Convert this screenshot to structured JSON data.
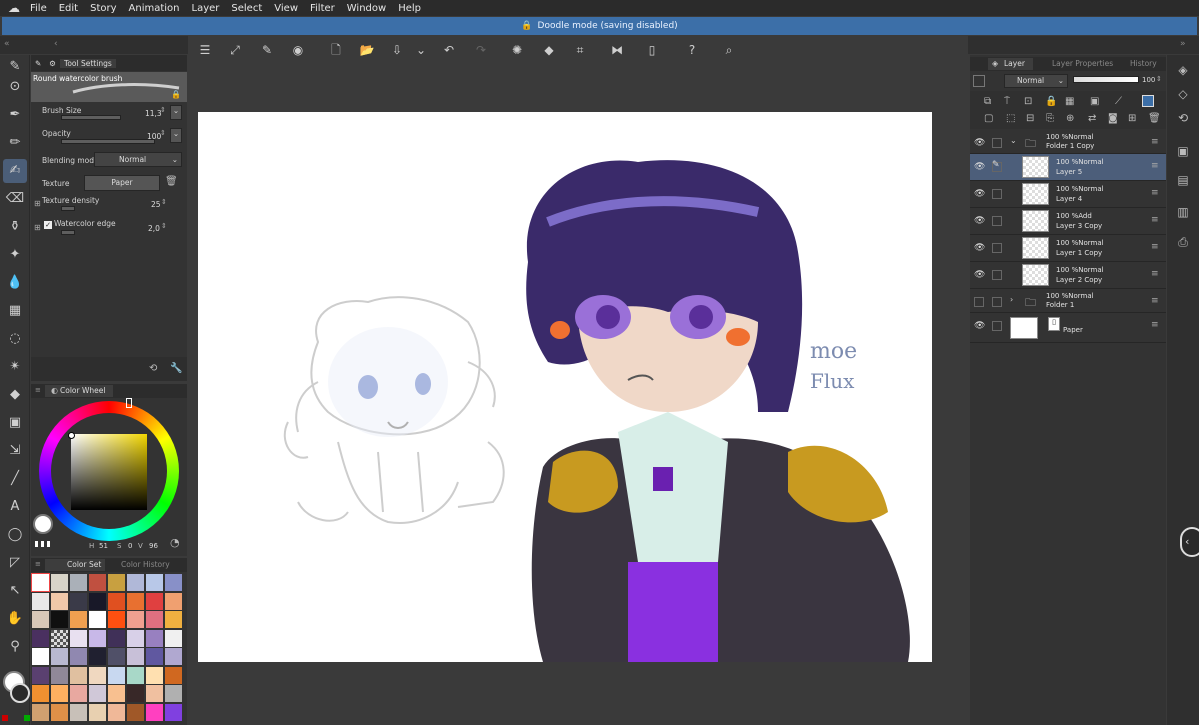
{
  "menu": [
    "File",
    "Edit",
    "Story",
    "Animation",
    "Layer",
    "Select",
    "View",
    "Filter",
    "Window",
    "Help"
  ],
  "notice": "Doodle mode (saving disabled)",
  "tool_settings": {
    "tab": "Tool Settings",
    "brush_name": "Round watercolor brush",
    "brush_size_label": "Brush Size",
    "brush_size_value": "11,3",
    "opacity_label": "Opacity",
    "opacity_value": "100",
    "blending_label": "Blending mode",
    "blending_value": "Normal",
    "texture_label": "Texture",
    "texture_value": "Paper",
    "texture_density_label": "Texture density",
    "texture_density_value": "25",
    "watercolor_edge_label": "Watercolor edge",
    "watercolor_edge_value": "2,0"
  },
  "color_wheel": {
    "tab": "Color Wheel",
    "h": "H",
    "s": "51",
    "v": "96",
    "v_label": "V",
    "s_label": "S",
    "zero": "0"
  },
  "color_set": {
    "tab1": "Color Set",
    "tab2": "Color History",
    "swatches": [
      "#ffffff",
      "#d8d4c8",
      "#aab0b8",
      "#c05040",
      "#c8a040",
      "#b0b8d8",
      "#b8c8e8",
      "#8890c8",
      "#e8e8e8",
      "#f0c8a8",
      "#3a3a48",
      "#181828",
      "#e05020",
      "#e87030",
      "#e04040",
      "#f0a070",
      "#d8c8b8",
      "#101010",
      "#f0a050",
      "#ffffff",
      "#ff5010",
      "#f0a090",
      "#e07080",
      "#f0b040",
      "#4a3060",
      "#checker",
      "#e8e0f0",
      "#c8b8e8",
      "#403058",
      "#d8d0e8",
      "#9880c0",
      "#f0f0f0",
      "#ffffff",
      "#b8b8d0",
      "#9088b0",
      "#202030",
      "#505068",
      "#c8c0d8",
      "#6058a0",
      "#b0a8d0",
      "#5a4070",
      "#908898",
      "#e0c0a0",
      "#f0d8c0",
      "#c8d8f0",
      "#a8d8c8",
      "#ffe0b0",
      "#d06820",
      "#f09030",
      "#ffb060",
      "#e8a8a0",
      "#d0c8d8",
      "#f8c090",
      "#382828",
      "#f0c0a0",
      "#b0b0b0",
      "#d0a070",
      "#e09048",
      "#c8c0b8",
      "#e8d0b0",
      "#f0b898",
      "#a05828",
      "#ff40c0",
      "#8040e0"
    ]
  },
  "layer_panel": {
    "tabs": [
      "Layer",
      "Layer Properties",
      "History"
    ],
    "blend": "Normal",
    "opacity": "100",
    "layers": [
      {
        "line1": "100 %Normal",
        "line2": "Folder 1 Copy",
        "type": "folder",
        "open": true
      },
      {
        "line1": "100 %Normal",
        "line2": "Layer 5",
        "type": "layer",
        "selected": true
      },
      {
        "line1": "100 %Normal",
        "line2": "Layer 4",
        "type": "layer"
      },
      {
        "line1": "100 %Add",
        "line2": "Layer 3 Copy",
        "type": "layer"
      },
      {
        "line1": "100 %Normal",
        "line2": "Layer 1 Copy",
        "type": "layer"
      },
      {
        "line1": "100 %Normal",
        "line2": "Layer 2 Copy",
        "type": "layer"
      },
      {
        "line1": "100 %Normal",
        "line2": "Folder 1",
        "type": "folder",
        "open": false
      },
      {
        "line1": "",
        "line2": "Paper",
        "type": "paper"
      }
    ]
  },
  "canvas_text": {
    "signature_line1": "moe",
    "signature_line2": "Flux"
  },
  "colors": {
    "accent": "#3c6fa8",
    "selected_layer": "#4c5e7a",
    "bg": "#3a3a3a"
  }
}
